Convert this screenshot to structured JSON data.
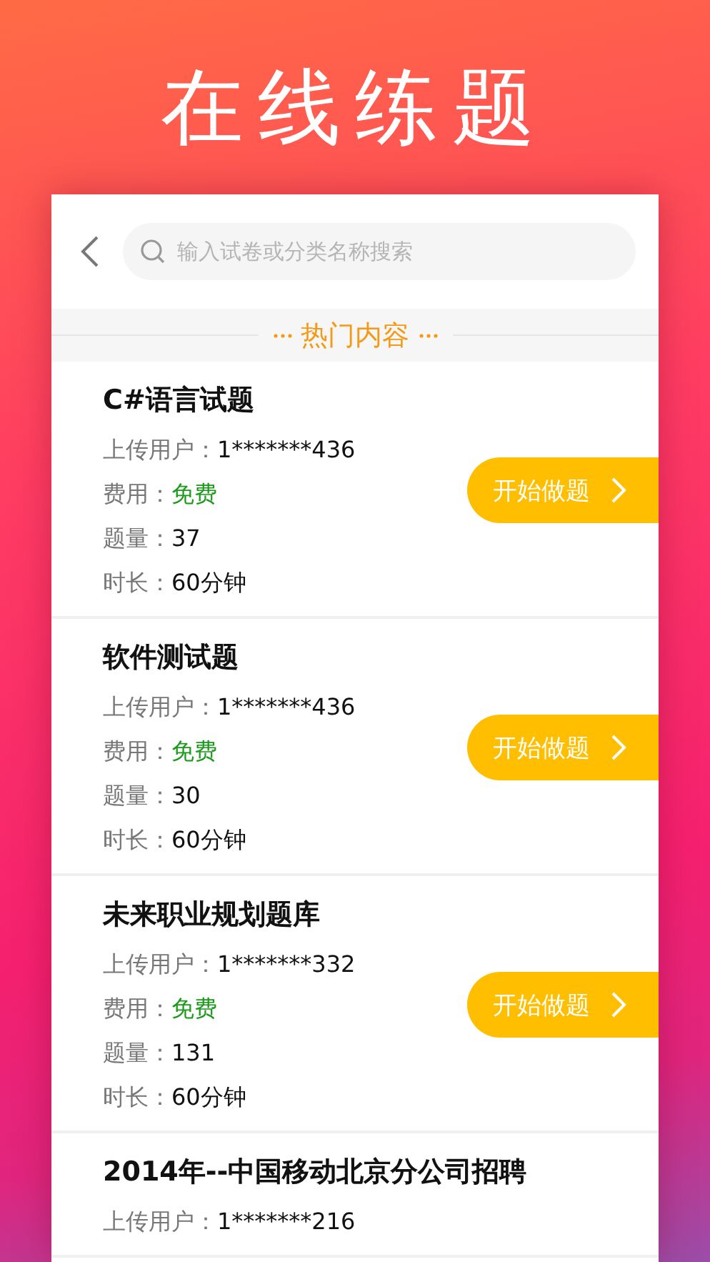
{
  "headline": "在线练题",
  "search": {
    "placeholder": "输入试卷或分类名称搜索"
  },
  "section_title": "热门内容",
  "papers": [
    {
      "title": "C#语言试题",
      "fields": [
        {
          "label": "上传用户：",
          "value": "1*******436",
          "kind": "plain"
        },
        {
          "label": "费用：",
          "value": "免费",
          "kind": "free"
        },
        {
          "label": "题量：",
          "value": "37",
          "kind": "plain"
        },
        {
          "label": "时长：",
          "value": "60分钟",
          "kind": "plain"
        }
      ],
      "button": "开始做题"
    },
    {
      "title": "软件测试题",
      "fields": [
        {
          "label": "上传用户：",
          "value": "1*******436",
          "kind": "plain"
        },
        {
          "label": "费用：",
          "value": "免费",
          "kind": "free"
        },
        {
          "label": "题量：",
          "value": "30",
          "kind": "plain"
        },
        {
          "label": "时长：",
          "value": "60分钟",
          "kind": "plain"
        }
      ],
      "button": "开始做题"
    },
    {
      "title": "未来职业规划题库",
      "fields": [
        {
          "label": "上传用户：",
          "value": "1*******332",
          "kind": "plain"
        },
        {
          "label": "费用：",
          "value": "免费",
          "kind": "free"
        },
        {
          "label": "题量：",
          "value": "131",
          "kind": "plain"
        },
        {
          "label": "时长：",
          "value": "60分钟",
          "kind": "plain"
        }
      ],
      "button": "开始做题"
    },
    {
      "title": "2014年--中国移动北京分公司招聘",
      "fields": [
        {
          "label": "上传用户：",
          "value": "1*******216",
          "kind": "plain"
        }
      ]
    }
  ]
}
